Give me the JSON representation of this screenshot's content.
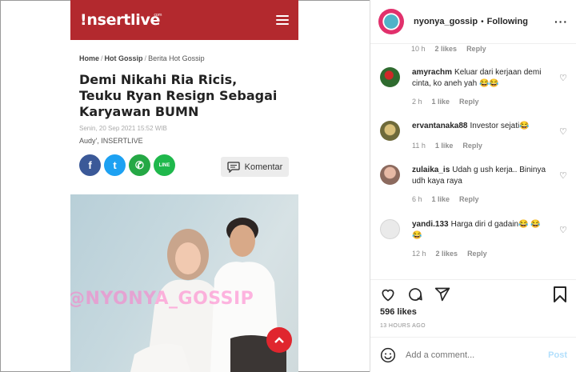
{
  "article": {
    "logo": "!nsertlive",
    "logo_sup": "com",
    "breadcrumb": [
      "Home",
      "Hot Gossip",
      "Berita Hot Gossip"
    ],
    "headline": "Demi Nikahi Ria Ricis, Teuku Ryan Resign Sebagai Karyawan BUMN",
    "date": "Senin, 20 Sep 2021 15:52 WIB",
    "author": "Audy', INSERTLIVE",
    "share_icons": [
      "facebook-icon",
      "twitter-icon",
      "whatsapp-icon",
      "line-icon"
    ],
    "fb": "f",
    "tw": "t",
    "wa": "✆",
    "line": "LINE",
    "komentar": "Komentar",
    "watermark": "@NYONYA_GOSSIP",
    "accent": "#b3292e"
  },
  "instagram": {
    "username": "nyonya_gossip",
    "dot": "•",
    "follow_state": "Following",
    "more": "···",
    "top_meta": {
      "time": "10 h",
      "likes": "2 likes",
      "reply": "Reply"
    },
    "comments": [
      {
        "user": "amyrachm",
        "text": "Keluar dari kerjaan demi cinta, ko aneh yah 😂😂",
        "time": "2 h",
        "likes": "1 like",
        "reply": "Reply"
      },
      {
        "user": "ervantanaka88",
        "text": "Investor sejati😂",
        "time": "11 h",
        "likes": "1 like",
        "reply": "Reply"
      },
      {
        "user": "zulaika_is",
        "text": "Udah g ush kerja.. Bininya udh kaya raya",
        "time": "6 h",
        "likes": "1 like",
        "reply": "Reply"
      },
      {
        "user": "yandi.133",
        "text": "Harga diri d gadain😂 😂😂",
        "time": "12 h",
        "likes": "2 likes",
        "reply": "Reply"
      }
    ],
    "likes": "596 likes",
    "time_ago": "13 HOURS AGO",
    "add_comment_placeholder": "Add a comment...",
    "post": "Post"
  }
}
